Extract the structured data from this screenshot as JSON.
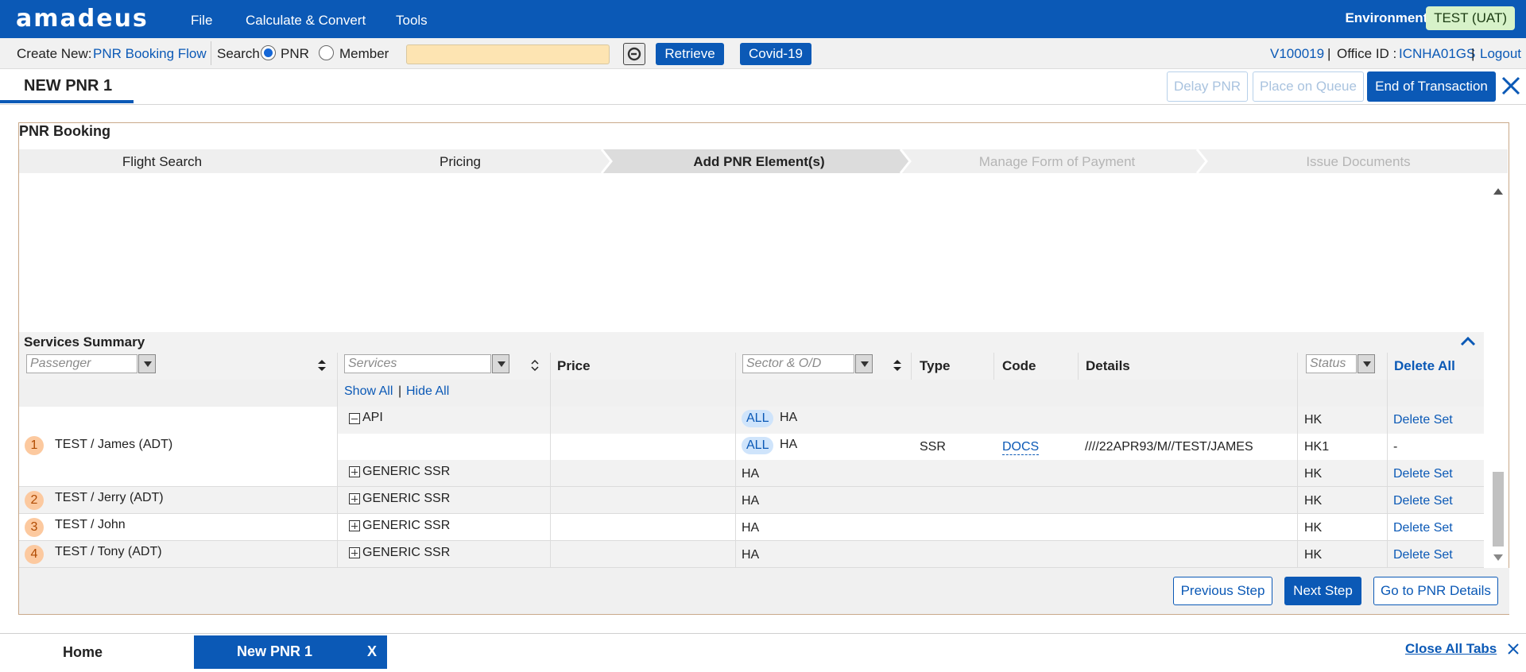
{
  "app": {
    "logo": "amadeus"
  },
  "menu": {
    "file": "File",
    "calculate": "Calculate & Convert",
    "tools": "Tools"
  },
  "environment": {
    "label": "Environment:",
    "value": "TEST (UAT)"
  },
  "subbar": {
    "create_new_label": "Create New:",
    "create_new_link": "PNR Booking Flow",
    "search_label": "Search",
    "radio_pnr": "PNR",
    "radio_member": "Member",
    "search_value": "",
    "retrieve": "Retrieve",
    "covid": "Covid-19",
    "user_id": "V100019",
    "sep1": "|",
    "office_label": "Office ID :",
    "office_id": "ICNHA01GS",
    "sep2": "|",
    "logout": "Logout"
  },
  "pnr_tab": {
    "title": "NEW PNR 1"
  },
  "actions": {
    "delay": "Delay PNR",
    "queue": "Place on Queue",
    "eot": "End of Transaction"
  },
  "booking": {
    "title": "PNR Booking",
    "steps": [
      "Flight Search",
      "Pricing",
      "Add PNR Element(s)",
      "Manage Form of Payment",
      "Issue Documents"
    ],
    "active_step": 2
  },
  "services": {
    "title": "Services Summary",
    "filters": {
      "passenger": "Passenger",
      "services": "Services",
      "sector": "Sector & O/D",
      "status": "Status"
    },
    "headers": {
      "price": "Price",
      "type": "Type",
      "code": "Code",
      "details": "Details",
      "delete_all": "Delete All"
    },
    "show_all": "Show All",
    "sep": "|",
    "hide_all": "Hide All",
    "passengers": [
      {
        "num": "1",
        "name": "TEST / James (ADT)"
      },
      {
        "num": "2",
        "name": "TEST / Jerry (ADT)"
      },
      {
        "num": "3",
        "name": "TEST / John"
      },
      {
        "num": "4",
        "name": "TEST / Tony (ADT)"
      }
    ],
    "rows": [
      {
        "service": "API",
        "all": "ALL",
        "sector": "HA",
        "type": "",
        "code": "",
        "details": "",
        "status": "HK",
        "action": "Delete Set"
      },
      {
        "service": "",
        "all": "ALL",
        "sector": "HA",
        "type": "SSR",
        "code": "DOCS",
        "details": "////22APR93/M//TEST/JAMES",
        "status": "HK1",
        "action": "-"
      },
      {
        "service": "GENERIC SSR",
        "all": "",
        "sector": "HA",
        "type": "",
        "code": "",
        "details": "",
        "status": "HK",
        "action": "Delete Set"
      },
      {
        "service": "GENERIC SSR",
        "all": "",
        "sector": "HA",
        "type": "",
        "code": "",
        "details": "",
        "status": "HK",
        "action": "Delete Set"
      },
      {
        "service": "GENERIC SSR",
        "all": "",
        "sector": "HA",
        "type": "",
        "code": "",
        "details": "",
        "status": "HK",
        "action": "Delete Set"
      },
      {
        "service": "GENERIC SSR",
        "all": "",
        "sector": "HA",
        "type": "",
        "code": "",
        "details": "",
        "status": "HK",
        "action": "Delete Set"
      }
    ]
  },
  "footer_buttons": {
    "previous": "Previous Step",
    "next": "Next Step",
    "details": "Go to PNR Details"
  },
  "bottom_tabs": {
    "home": "Home",
    "new_pnr": "New PNR 1",
    "close_tab": "X",
    "close_all": "Close All Tabs"
  },
  "colors": {
    "brand": "#0b59b6",
    "env_badge": "#d7f2c9",
    "search_input": "#fde4b2",
    "badge_orange": "#fcc99f"
  }
}
